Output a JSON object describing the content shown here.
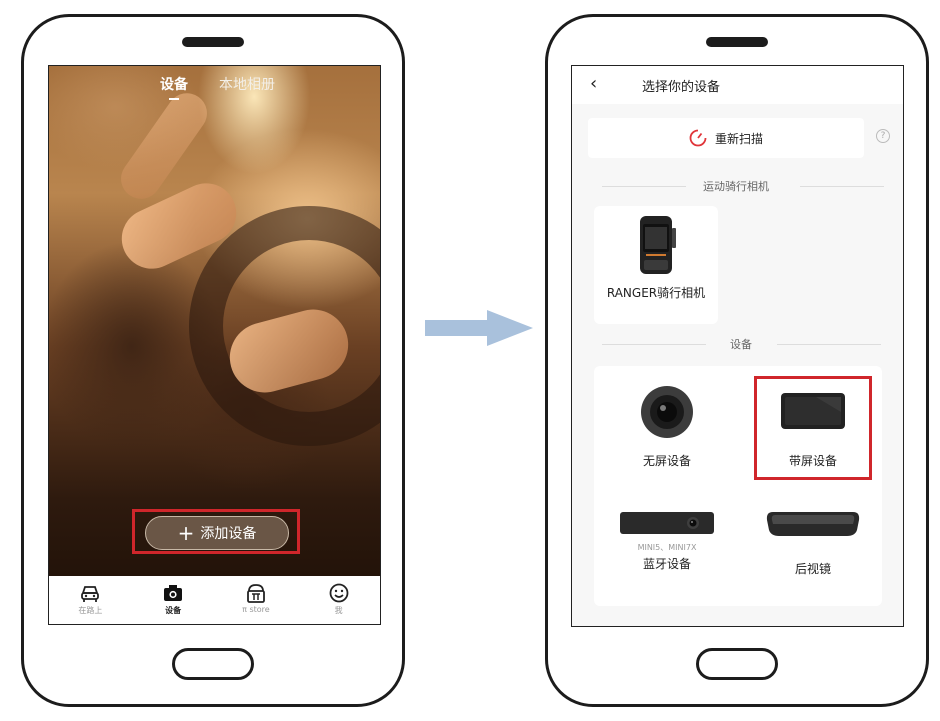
{
  "left_phone": {
    "top_tabs": [
      {
        "label": "设备",
        "active": true
      },
      {
        "label": "本地相册",
        "active": false
      }
    ],
    "add_device_button": {
      "icon": "plus-icon",
      "label": "添加设备"
    },
    "bottom_nav": [
      {
        "icon": "car-icon",
        "label": "在路上",
        "active": false
      },
      {
        "icon": "camera-icon",
        "label": "设备",
        "active": true
      },
      {
        "icon": "pi-store-icon",
        "label": "π store",
        "active": false
      },
      {
        "icon": "smile-icon",
        "label": "我",
        "active": false
      }
    ]
  },
  "right_phone": {
    "header": {
      "back_icon": "chevron-left-icon",
      "title": "选择你的设备"
    },
    "rescan": {
      "icon": "refresh-icon",
      "label": "重新扫描",
      "help_glyph": "?"
    },
    "section_sport": "运动骑行相机",
    "sport_devices": [
      {
        "name": "RANGER骑行相机",
        "icon": "ranger-camera-icon"
      }
    ],
    "section_devices": "设备",
    "devices": [
      {
        "name": "无屏设备",
        "icon": "round-camera-icon"
      },
      {
        "name": "带屏设备",
        "icon": "screen-device-icon",
        "highlighted": true
      },
      {
        "name": "蓝牙设备",
        "sub": "MINI5、MINI7X",
        "icon": "bar-camera-icon"
      },
      {
        "name": "后视镜",
        "icon": "rearview-mirror-icon"
      }
    ]
  },
  "colors": {
    "highlight": "#d0262b",
    "arrow": "#a9c1dc",
    "rescan_icon": "#e0353a"
  }
}
